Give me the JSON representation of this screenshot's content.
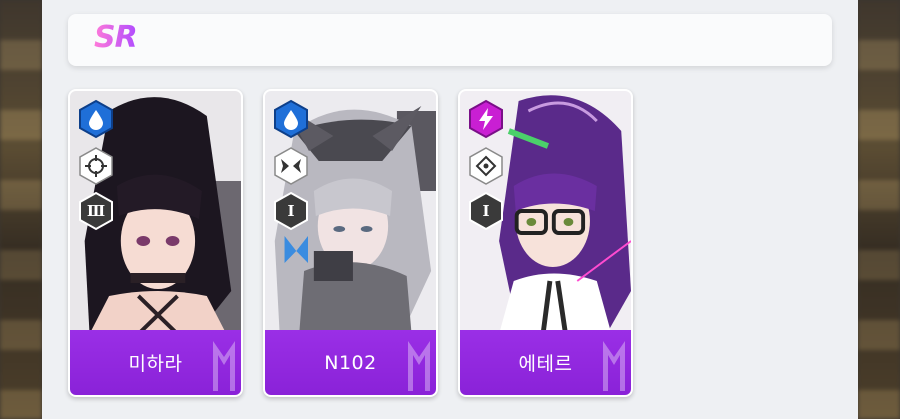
{
  "section": {
    "rarity_label": "SR"
  },
  "cards": [
    {
      "name": "미하라",
      "element_icon": "water-drop-icon",
      "element_color": "#1f6fd8",
      "class_icon": "crosshair-icon",
      "burst_label": "Ⅲ"
    },
    {
      "name": "N102",
      "element_icon": "water-drop-icon",
      "element_color": "#1f6fd8",
      "class_icon": "wings-icon",
      "burst_label": "Ⅰ"
    },
    {
      "name": "에테르",
      "element_icon": "lightning-icon",
      "element_color": "#c91fd3",
      "class_icon": "target-reticle-icon",
      "burst_label": "Ⅰ"
    }
  ],
  "colors": {
    "name_bar": "#8a22d8",
    "panel_bg": "#eef0f3",
    "rarity_gradient_start": "#ff7ad9",
    "rarity_gradient_end": "#b04cff"
  }
}
